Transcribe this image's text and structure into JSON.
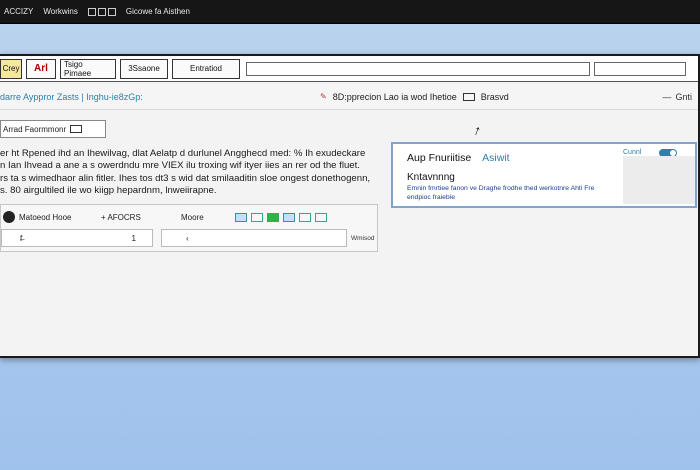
{
  "os_bar": {
    "app_label": "ACCIZY",
    "menu_text": "Workwins",
    "icons": [
      "window-icon",
      "grid-icon",
      "square-icon"
    ],
    "status_text": "Gicowe fa Aisthen"
  },
  "toolbar": {
    "btn1_label": "Crey",
    "btn2_label": "Arl",
    "btn3_label": "Tsigo Pimaee",
    "btn4_label": "3Ssaone",
    "btn5_label": "Entratiod",
    "input_a_value": "",
    "input_b_value": ""
  },
  "address": {
    "path": "darre Ayppror Zasts | Inghu-ie8zGp:",
    "center_text": "8D:pprecion Lao ia wod Ihetioe",
    "center_tag": "Brasvd",
    "right_text": "Gnti"
  },
  "left": {
    "section_label": "Arrad Faormmonr",
    "paragraph_lines": [
      "er ht Rpened ihd an Ihewilvag, dlat Aelatp d durlunel Angghecd med: % Ih exudeckare",
      "n Ian Ihvead a ane a s owerdndu mre VIEX ilu troxing wif ityer iies an rer od the fluet.",
      "rs ta s wimedhaor alin fitler. Ihes tos dt3 s wid dat smilaaditin sloe ongest donethogenn,",
      "s. 80 airgultiled ile wo kiigp hepardnm, lnweiirapne."
    ],
    "form": {
      "label1": "Matoeod Hooe",
      "label2": "+ AFOCRS",
      "label3": "Moore",
      "field_a_prefix": "f̶",
      "field_a_value": "1",
      "field_b_value": "‹",
      "field_b_suffix": "Wmisod"
    }
  },
  "card": {
    "title": "Aup Fnuriitise",
    "title_accent": "Asiwit",
    "toggle_label": "Cunnl",
    "subtitle": "Kntavnnng",
    "description": "Emnin fmrtiee fanon ve Draghe frodhe thed werkotnre Ahti Fre endpioc fraiebie"
  },
  "colors": {
    "accent": "#2f7fa6",
    "card_border": "#7fa4cf",
    "desc_text": "#1a3f8f"
  }
}
